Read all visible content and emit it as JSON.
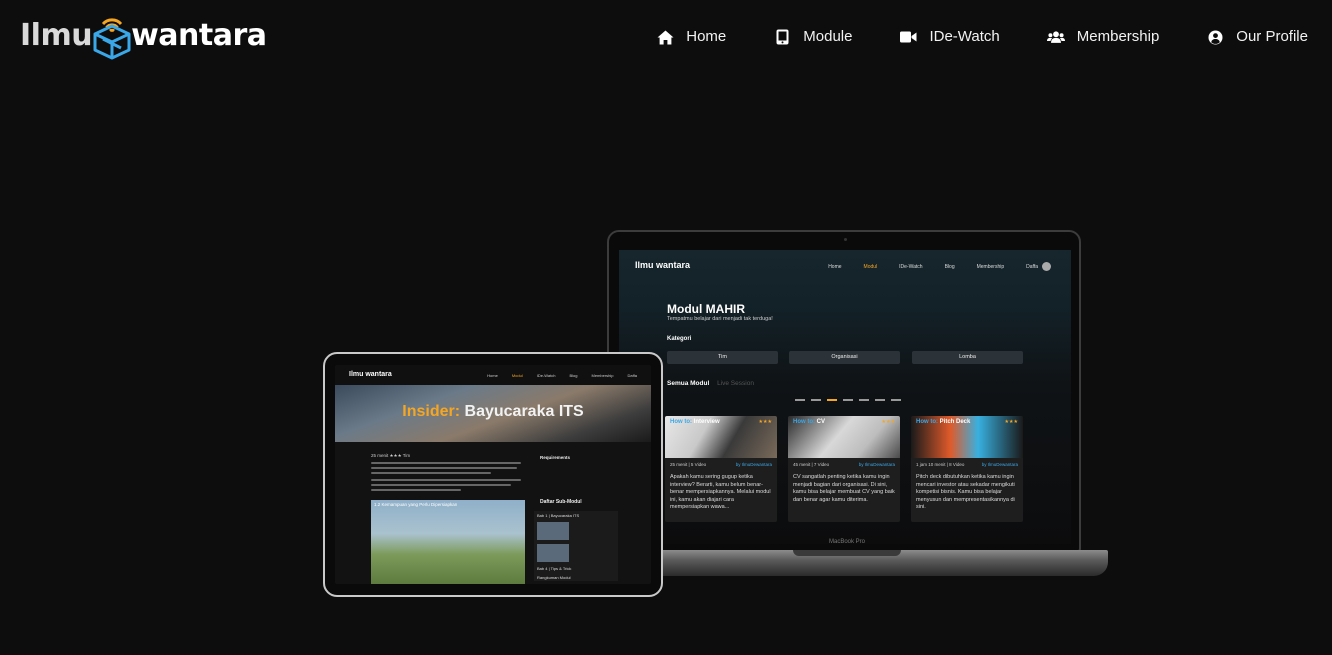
{
  "brand": {
    "left": "Ilmu",
    "right": "wantara",
    "colors": {
      "logo_orange": "#f5a623",
      "logo_blue": "#3aa8e8",
      "text": "#ffffff",
      "background": "#0d0d0d"
    }
  },
  "nav": {
    "items": [
      {
        "label": "Home",
        "icon": "home-icon"
      },
      {
        "label": "Module",
        "icon": "tablet-icon"
      },
      {
        "label": "IDe-Watch",
        "icon": "video-camera-icon"
      },
      {
        "label": "Membership",
        "icon": "users-icon"
      },
      {
        "label": "Our Profile",
        "icon": "user-circle-icon"
      }
    ]
  },
  "laptop": {
    "model": "MacBook Pro",
    "screen": {
      "logo": "Ilmu wantara",
      "links": [
        "Home",
        "Modul",
        "IDe-Watch",
        "Blog",
        "Membership",
        "Daffa"
      ],
      "active_link": "Modul",
      "title": "Modul MAHIR",
      "subtitle": "Tempatmu belajar dari menjadi tak terduga!",
      "kategori_label": "Kategori",
      "chips": [
        "Tim",
        "Organisasi",
        "Lomba"
      ],
      "tab_active": "Semua Modul",
      "tab_inactive": "Live Session",
      "cards": [
        {
          "prefix": "How to:",
          "title": "Interview",
          "stars": "★★★",
          "meta": "25 menit | 5 Video",
          "by": "by IlmuDewantara",
          "desc": "Apakah kamu sering gugup ketika interview? Berarti, kamu belum benar-benar mempersiapkannya. Melalui modul ini, kamu akan diajari cara mempersiapkan wawa..."
        },
        {
          "prefix": "How to:",
          "title": "CV",
          "stars": "★★★",
          "meta": "45 menit | 7 Video",
          "by": "by IlmuDewantara",
          "desc": "CV sangatlah penting ketika kamu ingin menjadi bagian dari organisasi. Di sini, kamu bisa belajar membuat CV yang baik dan benar agar kamu diterima."
        },
        {
          "prefix": "How to:",
          "title": "Pitch Deck",
          "stars": "★★★",
          "meta": "1 jam 10 menit | 8 Video",
          "by": "by IlmuDewantara",
          "desc": "Pitch deck dibutuhkan ketika kamu ingin mencari investor atau sekadar mengikuti kompetisi bisnis. Kamu bisa belajar menyusun dan mempresentasikannya di sini."
        }
      ]
    }
  },
  "tablet": {
    "screen": {
      "logo": "Ilmu wantara",
      "links": [
        "Home",
        "Modul",
        "IDe-Watch",
        "Blog",
        "Membership",
        "Daffa"
      ],
      "active_link": "Modul",
      "hero_prefix": "Insider:",
      "hero_title": "Bayucaraka ITS",
      "meta": "25 menit   ★★★   Tim",
      "requirements_label": "Requirements",
      "submodul_label": "Daftar Sub-Modul",
      "video_caption": "1.2 Kemampuan yang Perlu Dipersiapkan",
      "panel_rows": [
        "Bab 1 | Bayucaraka ITS",
        "Bab 4 | Tips & Trick",
        "Rangkuman Modul"
      ]
    }
  }
}
